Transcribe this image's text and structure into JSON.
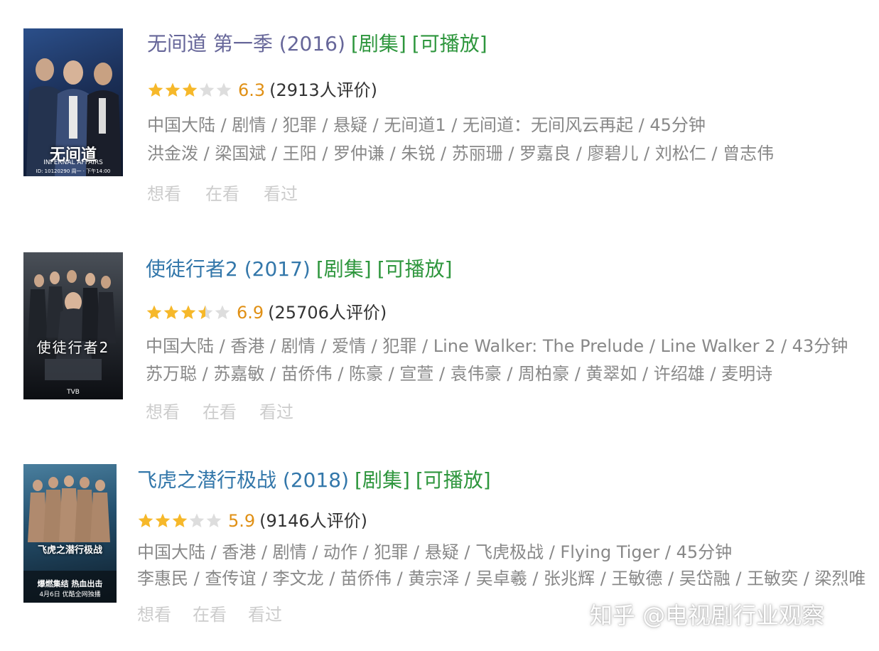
{
  "items": [
    {
      "title": "无间道 第一季 (2016)",
      "tags": [
        "[剧集]",
        "[可播放]"
      ],
      "rating": 6.3,
      "star_fill": 0.6,
      "score": "6.3",
      "votes": "(2913人评价)",
      "meta": "中国大陆 / 剧情 / 犯罪 / 悬疑 / 无间道1 / 无间道：无间风云再起 / 45分钟",
      "cast": "洪金泼 / 梁国斌 / 王阳 / 罗仲谦 / 朱锐 / 苏丽珊 / 罗嘉良 / 廖碧儿 / 刘松仁 / 曾志伟",
      "actions": [
        "想看",
        "在看",
        "看过"
      ],
      "poster": {
        "title": "无间道",
        "subtitle": "INFERNAL AFFAIRS",
        "footer": "ID: 10120290  周一 · 下午14:00",
        "colors": [
          "#1e3a6e",
          "#0b1a33"
        ]
      }
    },
    {
      "title": "使徒行者2 (2017)",
      "tags": [
        "[剧集]",
        "[可播放]"
      ],
      "rating": 6.9,
      "star_fill": 0.7,
      "score": "6.9",
      "votes": "(25706人评价)",
      "meta": "中国大陆 / 香港 / 剧情 / 爱情 / 犯罪 / Line Walker: The Prelude / Line Walker 2 / 43分钟",
      "cast": "苏万聪 / 苏嘉敏 / 苗侨伟 / 陈豪 / 宣萱 / 袁伟豪 / 周柏豪 / 黄翠如 / 许绍雄 / 麦明诗",
      "actions": [
        "想看",
        "在看",
        "看过"
      ],
      "poster": {
        "title": "使徒行者2",
        "subtitle": "",
        "footer": "TVB",
        "colors": [
          "#3a3f47",
          "#101216"
        ]
      }
    },
    {
      "title": "飞虎之潜行极战 (2018)",
      "tags": [
        "[剧集]",
        "[可播放]"
      ],
      "rating": 5.9,
      "star_fill": 0.6,
      "score": "5.9",
      "votes": "(9146人评价)",
      "meta": "中国大陆 / 香港 / 剧情 / 动作 / 犯罪 / 悬疑 / 飞虎极战 / Flying Tiger / 45分钟",
      "cast": "李惠民 / 查传谊 / 李文龙 / 苗侨伟 / 黄宗泽 / 吴卓羲 / 张兆辉 / 王敏德 / 吴岱融 / 王敏奕 / 梁烈唯",
      "actions": [
        "想看",
        "在看",
        "看过"
      ],
      "poster": {
        "title": "飞虎之潜行极战",
        "subtitle": "爆燃集结 热血出击",
        "footer": "4月6日 优酷全网独播",
        "colors": [
          "#2f5d7a",
          "#0e1c28"
        ]
      }
    }
  ],
  "watermark": "知乎 @电视剧行业观察",
  "colors": {
    "link": "#3377aa",
    "visited": "#666699",
    "tag": "#2e963d",
    "score": "#e09015",
    "star": "#f6b82a",
    "star_empty": "#dddddd",
    "meta": "#888888",
    "action": "#cccccc"
  }
}
